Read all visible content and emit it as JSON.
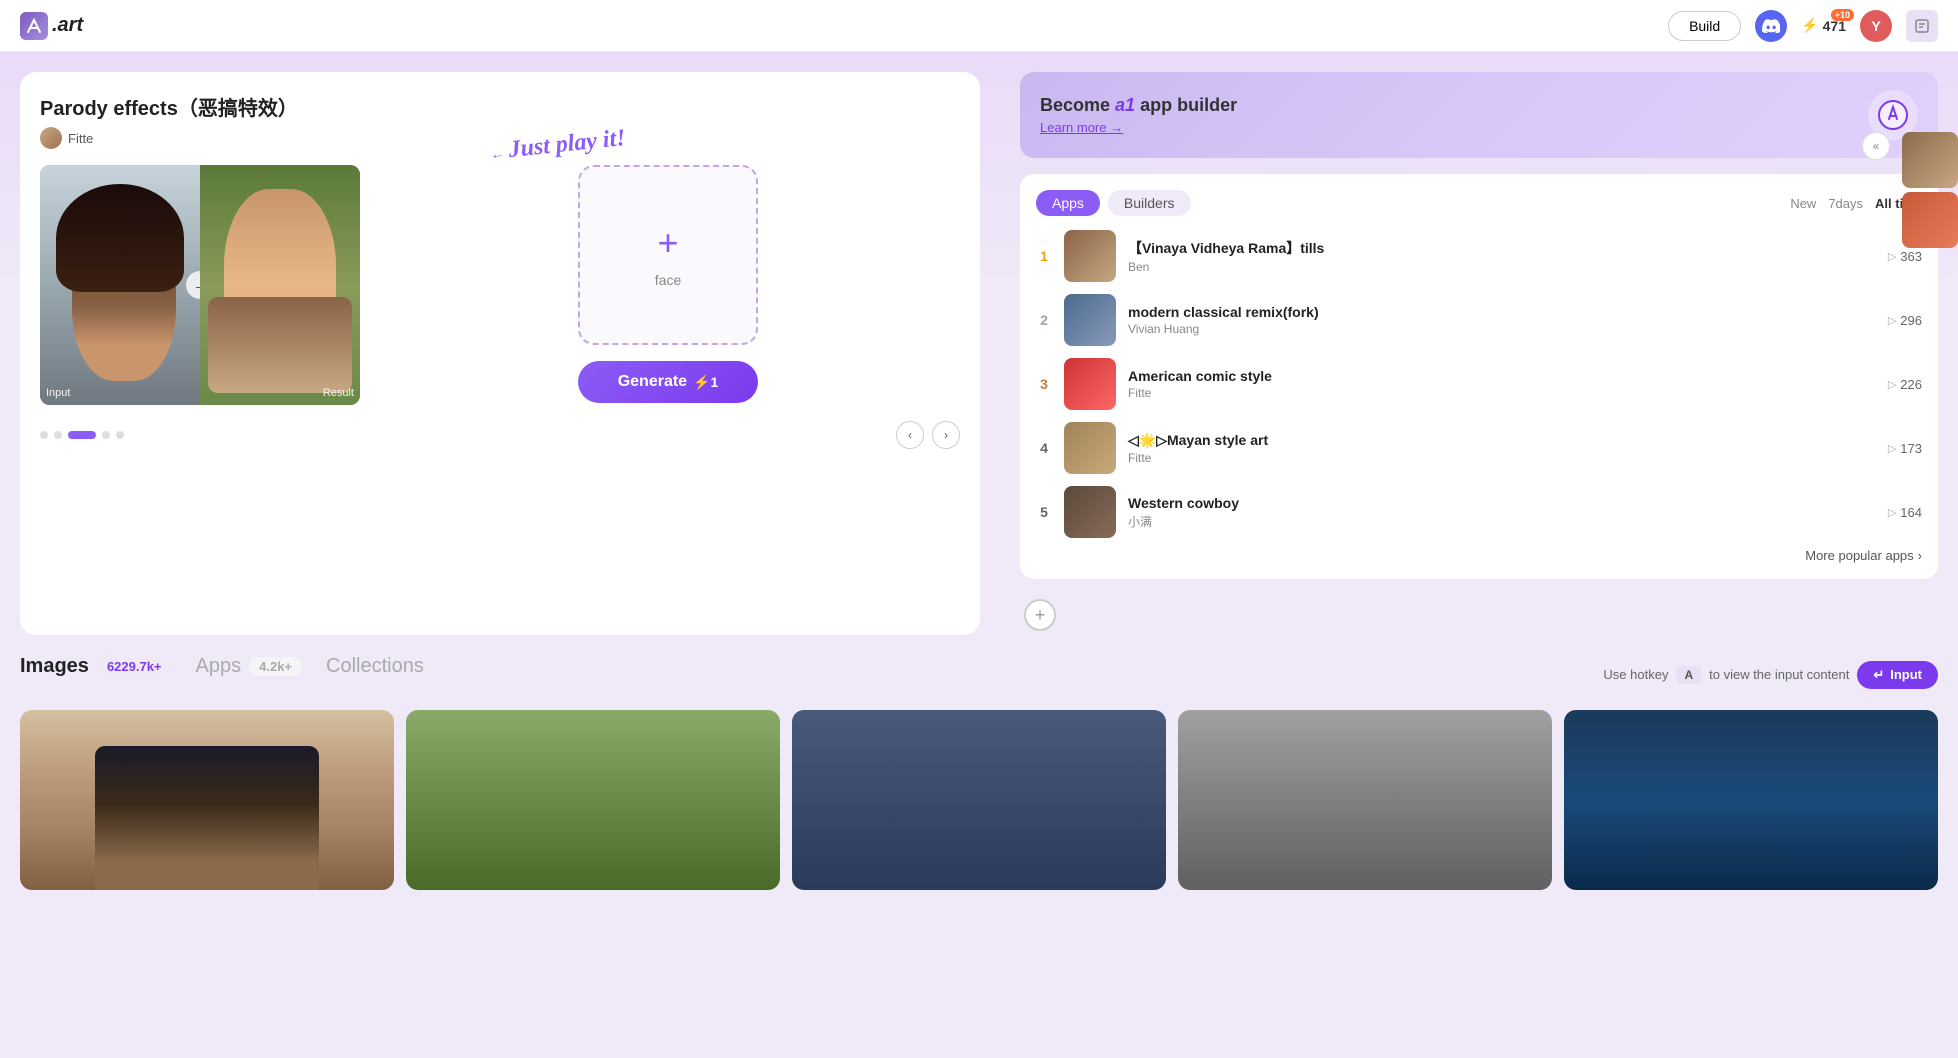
{
  "app": {
    "name": ".art",
    "logo_letter": "A"
  },
  "nav": {
    "build_label": "Build",
    "lightning_count": "471",
    "badge_plus": "+10",
    "avatar_letter": "Y"
  },
  "feature": {
    "title": "Parody effects（恶搞特效）",
    "author": "Fitte",
    "input_label": "Input",
    "result_label": "Result",
    "upload_label": "face",
    "generate_label": "Generate",
    "generate_cost": "⚡1",
    "play_label": "Just play it!",
    "dots": [
      "inactive",
      "inactive",
      "active",
      "inactive",
      "inactive"
    ]
  },
  "builder_banner": {
    "prefix": "Become",
    "highlight": "a1",
    "suffix": "app builder",
    "learn_more": "Learn more →"
  },
  "popular": {
    "tabs": [
      "Apps",
      "Builders"
    ],
    "active_tab": "Apps",
    "time_filters": [
      "New",
      "7days",
      "All time"
    ],
    "active_filter": "All time",
    "apps": [
      {
        "rank": "1",
        "name": "【Vinaya Vidheya Rama】tills",
        "author": "Ben",
        "count": "363"
      },
      {
        "rank": "2",
        "name": "modern classical remix(fork)",
        "author": "Vivian Huang",
        "count": "296"
      },
      {
        "rank": "3",
        "name": "American comic style",
        "author": "Fitte",
        "count": "226"
      },
      {
        "rank": "4",
        "name": "◁🌟▷Mayan style art",
        "author": "Fitte",
        "count": "173"
      },
      {
        "rank": "5",
        "name": "Western cowboy",
        "author": "小满",
        "count": "164"
      }
    ],
    "more_label": "More popular apps"
  },
  "bottom": {
    "tabs": [
      {
        "label": "Images",
        "badge": "6229.7k+",
        "active": true
      },
      {
        "label": "Apps",
        "badge": "4.2k+",
        "active": false
      },
      {
        "label": "Collections",
        "badge": "",
        "active": false
      }
    ],
    "hotkey_prefix": "Use hotkey",
    "hotkey_key": "A",
    "hotkey_suffix": "to view the input content",
    "input_btn": "Input"
  }
}
